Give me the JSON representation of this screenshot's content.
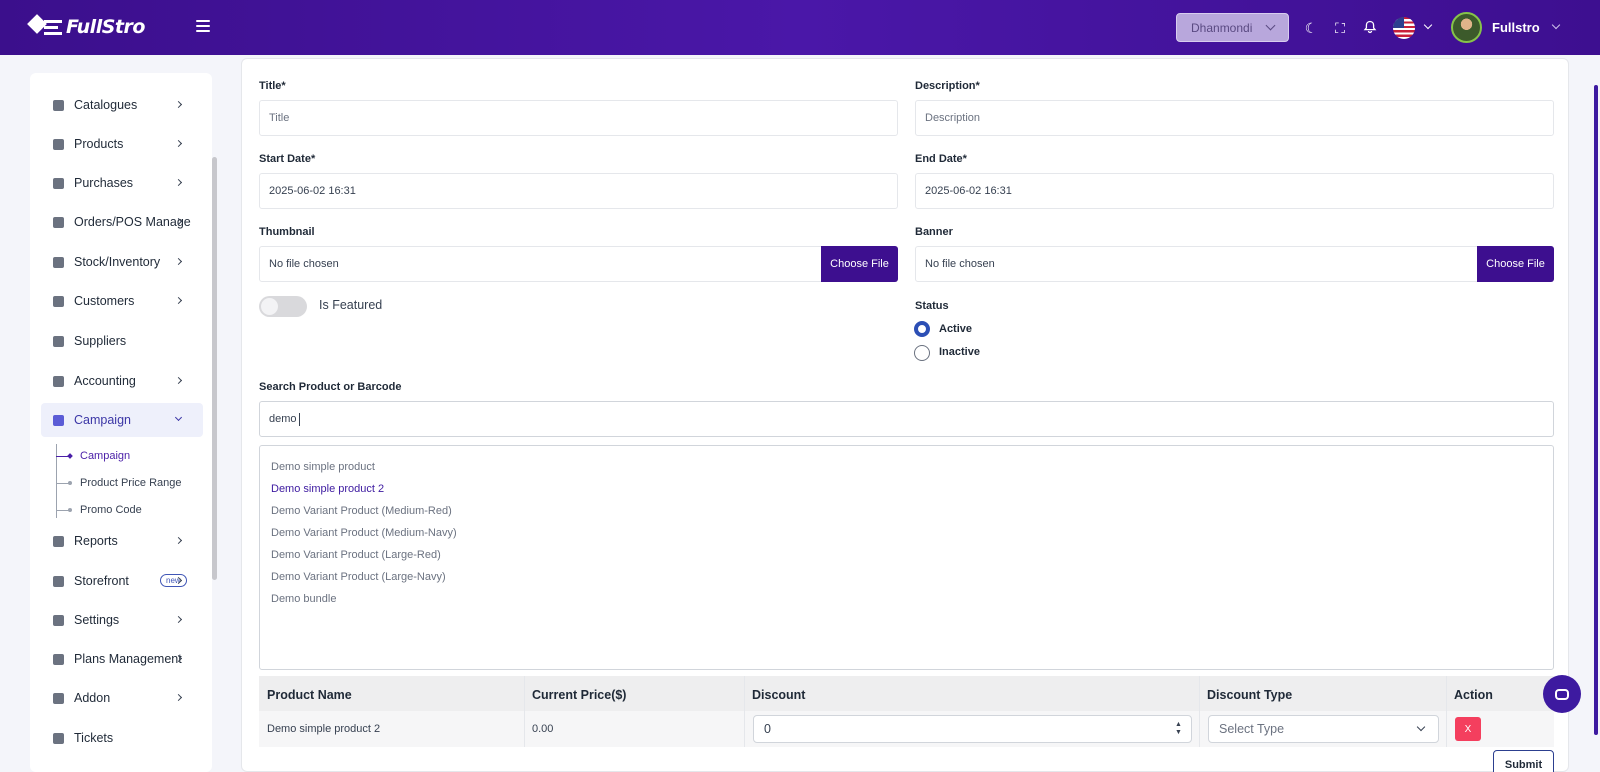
{
  "header": {
    "logo_text": "FullStro",
    "branch": "Dhanmondi",
    "user_name": "Fullstro"
  },
  "sidebar": {
    "items": [
      {
        "label": "Catalogues"
      },
      {
        "label": "Products"
      },
      {
        "label": "Purchases"
      },
      {
        "label": "Orders/POS Manage"
      },
      {
        "label": "Stock/Inventory"
      },
      {
        "label": "Customers"
      },
      {
        "label": "Suppliers"
      },
      {
        "label": "Accounting"
      },
      {
        "label": "Campaign"
      },
      {
        "label": "Reports"
      },
      {
        "label": "Storefront"
      },
      {
        "label": "Settings"
      },
      {
        "label": "Plans Management"
      },
      {
        "label": "Addon"
      },
      {
        "label": "Tickets"
      }
    ],
    "storefront_badge": "new",
    "campaign_sub": [
      "Campaign",
      "Product Price Range",
      "Promo Code"
    ]
  },
  "form": {
    "title_label": "Title*",
    "title_placeholder": "Title",
    "description_label": "Description*",
    "description_placeholder": "Description",
    "start_date_label": "Start Date*",
    "start_date_value": "2025-06-02 16:31",
    "end_date_label": "End Date*",
    "end_date_value": "2025-06-02 16:31",
    "thumbnail_label": "Thumbnail",
    "thumbnail_file": "No file chosen",
    "banner_label": "Banner",
    "banner_file": "No file chosen",
    "choose_file": "Choose File",
    "is_featured_label": "Is Featured",
    "status_label": "Status",
    "status_active": "Active",
    "status_inactive": "Inactive",
    "search_label": "Search Product or Barcode",
    "search_value": "demo"
  },
  "results": [
    "Demo simple product",
    "Demo simple product 2",
    "Demo Variant Product (Medium-Red)",
    "Demo Variant Product (Medium-Navy)",
    "Demo Variant Product (Large-Red)",
    "Demo Variant Product (Large-Navy)",
    "Demo bundle"
  ],
  "table": {
    "headers": [
      "Product Name",
      "Current Price($)",
      "Discount",
      "Discount Type",
      "Action"
    ],
    "row": {
      "product_name": "Demo simple product 2",
      "current_price": "0.00",
      "discount": "0",
      "discount_type_placeholder": "Select Type",
      "delete_label": "X"
    }
  },
  "submit_label": "Submit"
}
